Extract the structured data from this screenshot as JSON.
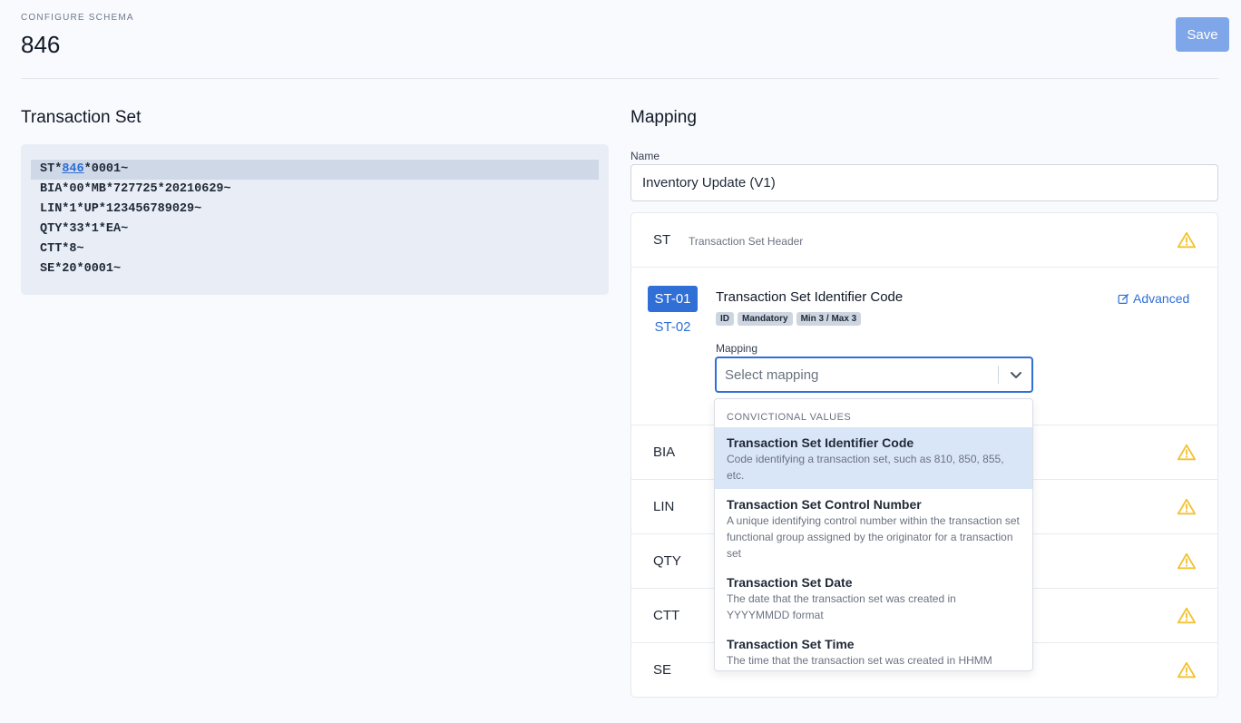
{
  "header": {
    "eyebrow": "CONFIGURE SCHEMA",
    "title": "846",
    "save_label": "Save"
  },
  "transaction_set": {
    "title": "Transaction Set",
    "lines": [
      {
        "prefix": "ST*",
        "highlight": "846",
        "suffix": "*0001~"
      },
      {
        "text": "BIA*00*MB*727725*20210629~"
      },
      {
        "text": "LIN*1*UP*123456789029~"
      },
      {
        "text": "QTY*33*1*EA~"
      },
      {
        "text": "CTT*8~"
      },
      {
        "text": "SE*20*0001~"
      }
    ]
  },
  "mapping": {
    "title": "Mapping",
    "name_label": "Name",
    "name_value": "Inventory Update (V1)",
    "segments": [
      {
        "code": "ST",
        "desc": "Transaction Set Header"
      },
      {
        "code": "BIA"
      },
      {
        "code": "LIN"
      },
      {
        "code": "QTY"
      },
      {
        "code": "CTT"
      },
      {
        "code": "SE"
      }
    ],
    "element": {
      "tabs": [
        "ST-01",
        "ST-02"
      ],
      "title": "Transaction Set Identifier Code",
      "badges": [
        "ID",
        "Mandatory",
        "Min 3 / Max 3"
      ],
      "advanced_label": "Advanced",
      "mapping_label": "Mapping",
      "select_placeholder": "Select mapping"
    },
    "dropdown": {
      "group_label": "CONVICTIONAL VALUES",
      "options": [
        {
          "title": "Transaction Set Identifier Code",
          "desc": "Code identifying a transaction set, such as 810, 850, 855, etc."
        },
        {
          "title": "Transaction Set Control Number",
          "desc": "A unique identifying control number within the transaction set functional group assigned by the originator for a transaction set"
        },
        {
          "title": "Transaction Set Date",
          "desc": "The date that the transaction set was created in YYYYMMDD format"
        },
        {
          "title": "Transaction Set Time",
          "desc": "The time that the transaction set was created in HHMM"
        }
      ]
    }
  },
  "colors": {
    "accent": "#2f6fd6",
    "save_button": "#7ea6e8",
    "warning": "#f2c230"
  }
}
